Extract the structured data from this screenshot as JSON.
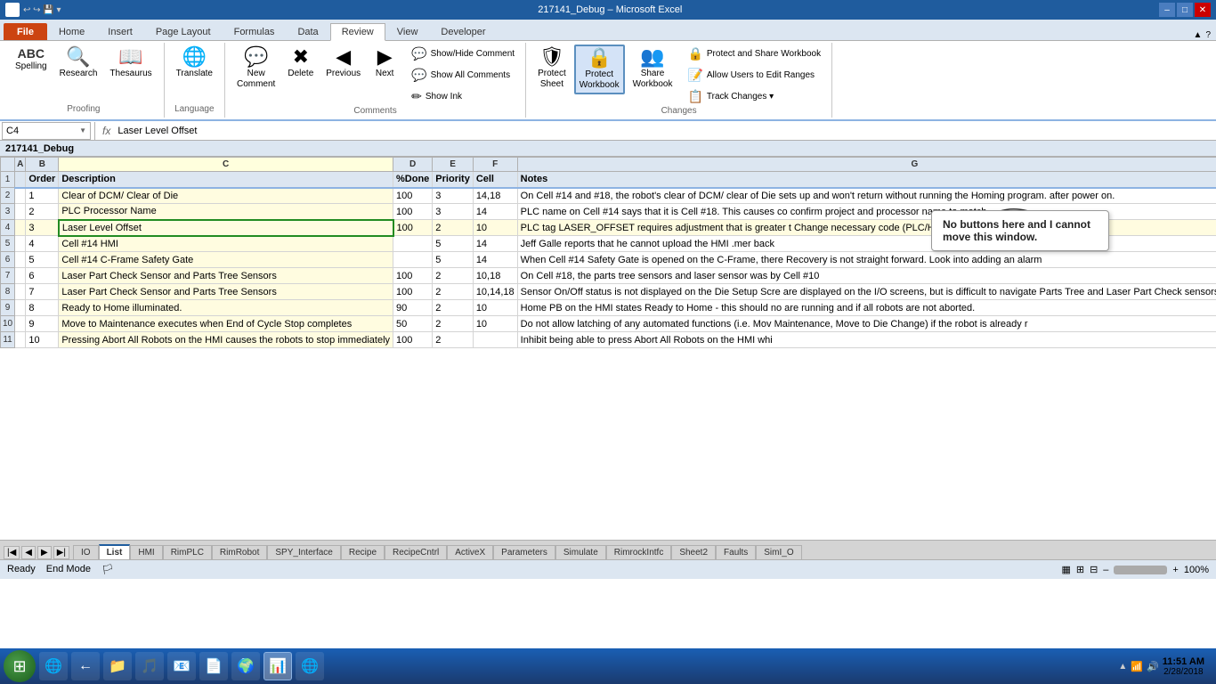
{
  "window": {
    "title": "217141_Debug – Microsoft Excel"
  },
  "title_bar": {
    "title": "217141_Debug – Microsoft Excel",
    "min_btn": "–",
    "max_btn": "□",
    "close_btn": "✕",
    "quick_access": [
      "↩",
      "↪",
      "💾"
    ]
  },
  "ribbon_tabs": [
    "File",
    "Home",
    "Insert",
    "Page Layout",
    "Formulas",
    "Data",
    "Review",
    "View",
    "Developer"
  ],
  "active_tab": "Review",
  "ribbon_groups": {
    "proofing": {
      "label": "Proofing",
      "buttons": [
        {
          "label": "Spelling",
          "icon": "ABC"
        },
        {
          "label": "Research",
          "icon": "🔍"
        },
        {
          "label": "Thesaurus",
          "icon": "📖"
        }
      ]
    },
    "language": {
      "label": "Language",
      "buttons": [
        {
          "label": "Translate",
          "icon": "🌐"
        }
      ]
    },
    "comments": {
      "label": "Comments",
      "main_buttons": [
        {
          "label": "New\nComment",
          "icon": "💬"
        },
        {
          "label": "Delete",
          "icon": "✖"
        },
        {
          "label": "Previous",
          "icon": "◀"
        },
        {
          "label": "Next",
          "icon": "▶"
        }
      ],
      "small_buttons": [
        {
          "label": "Show/Hide Comment",
          "icon": "💬"
        },
        {
          "label": "Show All Comments",
          "icon": "💬"
        },
        {
          "label": "Show Ink",
          "icon": "✏"
        }
      ]
    },
    "protect": {
      "label": "Changes",
      "protect_sheet": {
        "label": "Protect\nSheet",
        "icon": "🛡"
      },
      "protect_workbook": {
        "label": "Protect\nWorkbook",
        "icon": "🔒"
      },
      "share_workbook": {
        "label": "Share\nWorkbook",
        "icon": "👥"
      },
      "small_buttons": [
        {
          "label": "Protect and Share Workbook",
          "icon": "🔒"
        },
        {
          "label": "Allow Users to Edit Ranges",
          "icon": "📝"
        },
        {
          "label": "Track Changes ▾",
          "icon": "📋"
        }
      ]
    }
  },
  "formula_bar": {
    "name_box": "C4",
    "formula": "Laser Level Offset"
  },
  "sheet_name": "217141_Debug",
  "columns": [
    "",
    "A",
    "B",
    "C",
    "D",
    "E",
    "F",
    "G"
  ],
  "rows": [
    {
      "row": 1,
      "cells": [
        "",
        "",
        "Order",
        "Description",
        "%Done",
        "Priority",
        "Cell",
        "Notes"
      ]
    },
    {
      "row": 2,
      "cells": [
        "",
        "",
        "1",
        "Clear of DCM/ Clear of Die",
        "100",
        "3",
        "14,18",
        "On Cell #14 and #18, the robot's clear of DCM/ clear of Die sets up and won't return without running the Homing program. after power on."
      ]
    },
    {
      "row": 3,
      "cells": [
        "",
        "",
        "2",
        "PLC Processor Name",
        "100",
        "3",
        "14",
        "PLC name on Cell #14 says that it is Cell #18.  This causes co confirm project and processor name to match."
      ]
    },
    {
      "row": 4,
      "cells": [
        "",
        "",
        "3",
        "Laser Level Offset",
        "100",
        "2",
        "10",
        "PLC tag LASER_OFFSET requires adjustment that is greater t Change necessary code (PLC/HMI) to allow for easier adjus"
      ]
    },
    {
      "row": 5,
      "cells": [
        "",
        "",
        "4",
        "Cell #14 HMI",
        "",
        "5",
        "14",
        "Jeff Galle reports that he cannot upload the HMI .mer back"
      ]
    },
    {
      "row": 6,
      "cells": [
        "",
        "",
        "5",
        "Cell #14 C-Frame Safety Gate",
        "",
        "5",
        "14",
        "When Cell #14 Safety Gate is opened on the C-Frame, there Recovery is not straight forward.  Look into adding an alarm"
      ]
    },
    {
      "row": 7,
      "cells": [
        "",
        "",
        "6",
        "Laser Part Check Sensor and Parts Tree Sensors",
        "100",
        "2",
        "10,18",
        "On Cell #18, the parts tree sensors and laser sensor was by Cell #10"
      ]
    },
    {
      "row": 8,
      "cells": [
        "",
        "",
        "7",
        "Laser Part Check Sensor and Parts Tree Sensors",
        "100",
        "2",
        "10,14,18",
        "Sensor On/Off status is not displayed on the Die Setup Scre are displayed on the I/O screens, but is difficult to navigate Parts Tree and Laser Part Check sensors on the Die Setup Sc"
      ]
    },
    {
      "row": 9,
      "cells": [
        "",
        "",
        "8",
        "Ready to Home illuminated.",
        "90",
        "2",
        "10",
        "Home PB on the HMI states Ready to Home - this should no are running and if all robots are not aborted."
      ]
    },
    {
      "row": 10,
      "cells": [
        "",
        "",
        "9",
        "Move to Maintenance executes when End of Cycle Stop completes",
        "50",
        "2",
        "10",
        "Do not allow latching of any automated functions (i.e. Mov Maintenance, Move to Die Change) if the robot is already r"
      ]
    },
    {
      "row": 11,
      "cells": [
        "",
        "",
        "10",
        "Pressing Abort All Robots on the HMI causes the robots to stop immediately",
        "100",
        "2",
        "",
        "Inhibit being able to press Abort All Robots on the HMI whi"
      ]
    }
  ],
  "sheet_tabs": [
    "IO",
    "List",
    "HMI",
    "RimPLC",
    "RimRobot",
    "SPY_Interface",
    "Recipe",
    "RecipeCntrl",
    "ActiveX",
    "Parameters",
    "Simulate",
    "RimrockIntfc",
    "Sheet2",
    "Faults",
    "SimI_O"
  ],
  "active_sheet": "List",
  "status_bar": {
    "left": [
      "Ready",
      "End Mode"
    ],
    "right": [
      "100%"
    ]
  },
  "annotation": {
    "text": "No buttons here and I cannot move this window."
  },
  "taskbar": {
    "time": "11:51 AM",
    "date": "2/28/2018"
  }
}
